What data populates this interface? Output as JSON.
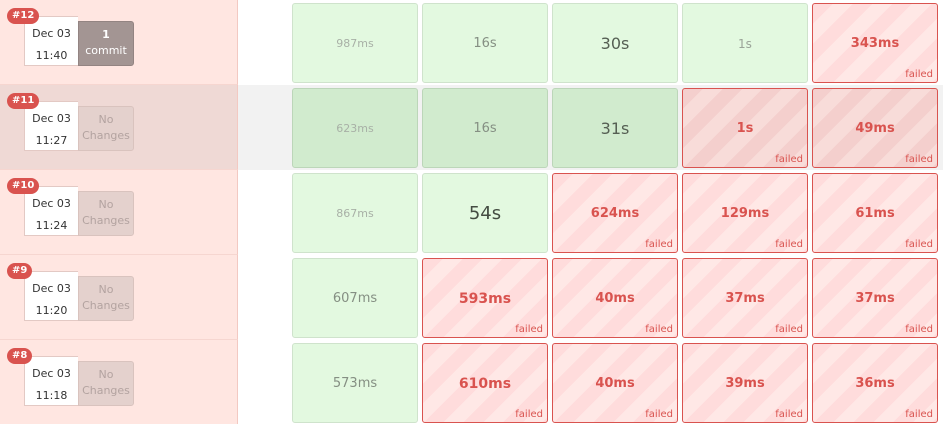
{
  "builds": [
    {
      "badge": "#12",
      "date": "Dec 03",
      "time": "11:40",
      "changes_line1": "1",
      "changes_line2": "commit",
      "stages": [
        {
          "time": "987ms",
          "status": "success"
        },
        {
          "time": "16s",
          "status": "success"
        },
        {
          "time": "30s",
          "status": "success"
        },
        {
          "time": "1s",
          "status": "success"
        },
        {
          "time": "343ms",
          "status": "failed"
        }
      ]
    },
    {
      "badge": "#11",
      "date": "Dec 03",
      "time": "11:27",
      "changes_line1": "No",
      "changes_line2": "Changes",
      "stages": [
        {
          "time": "623ms",
          "status": "success"
        },
        {
          "time": "16s",
          "status": "success"
        },
        {
          "time": "31s",
          "status": "success"
        },
        {
          "time": "1s",
          "status": "failed"
        },
        {
          "time": "49ms",
          "status": "failed"
        }
      ]
    },
    {
      "badge": "#10",
      "date": "Dec 03",
      "time": "11:24",
      "changes_line1": "No",
      "changes_line2": "Changes",
      "stages": [
        {
          "time": "867ms",
          "status": "success"
        },
        {
          "time": "54s",
          "status": "success"
        },
        {
          "time": "624ms",
          "status": "failed"
        },
        {
          "time": "129ms",
          "status": "failed"
        },
        {
          "time": "61ms",
          "status": "failed"
        }
      ]
    },
    {
      "badge": "#9",
      "date": "Dec 03",
      "time": "11:20",
      "changes_line1": "No",
      "changes_line2": "Changes",
      "stages": [
        {
          "time": "607ms",
          "status": "success"
        },
        {
          "time": "593ms",
          "status": "failed"
        },
        {
          "time": "40ms",
          "status": "failed"
        },
        {
          "time": "37ms",
          "status": "failed"
        },
        {
          "time": "37ms",
          "status": "failed"
        }
      ]
    },
    {
      "badge": "#8",
      "date": "Dec 03",
      "time": "11:18",
      "changes_line1": "No",
      "changes_line2": "Changes",
      "stages": [
        {
          "time": "573ms",
          "status": "success"
        },
        {
          "time": "610ms",
          "status": "failed"
        },
        {
          "time": "40ms",
          "status": "failed"
        },
        {
          "time": "39ms",
          "status": "failed"
        },
        {
          "time": "36ms",
          "status": "failed"
        }
      ]
    }
  ],
  "failed_label": "failed",
  "colors": {
    "success_bg": "#e3f9e0",
    "failed_accent": "#d9534f",
    "build_bg": "#ffe6e1",
    "commit_bg": "#a39593"
  }
}
